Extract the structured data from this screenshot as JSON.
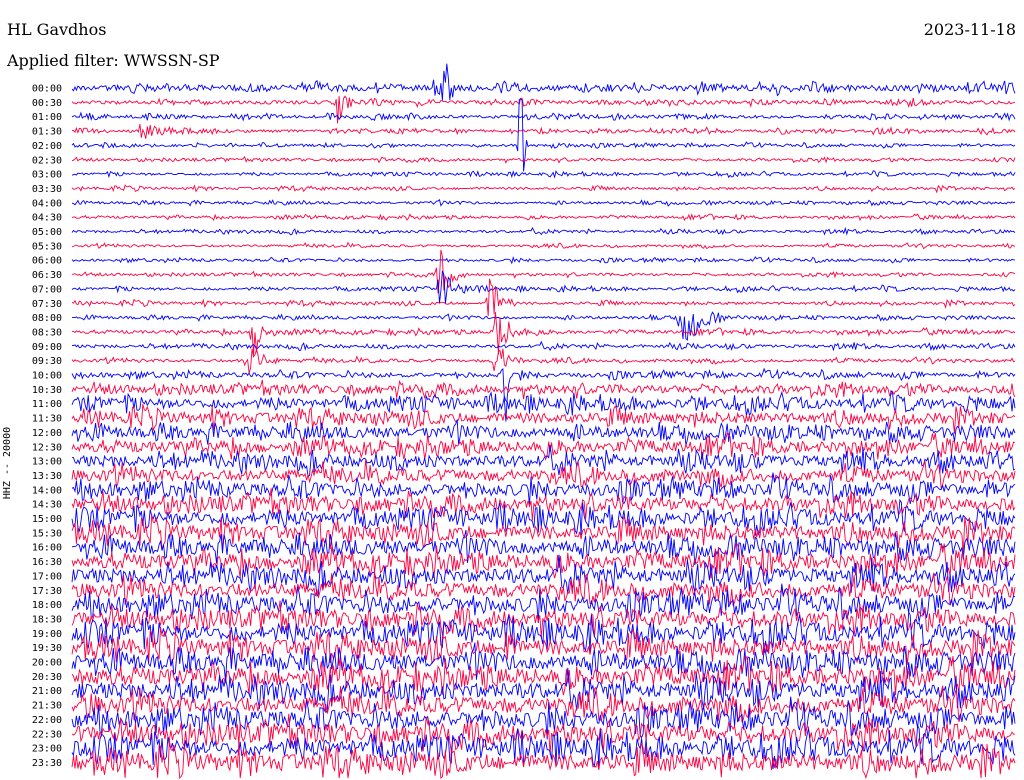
{
  "header": {
    "station": "HL Gavdhos",
    "date": "2023-11-18",
    "filter": "Applied filter: WWSSN-SP"
  },
  "chart_data": {
    "type": "line",
    "title": "HL Gavdhos",
    "ylabel": "HHZ -- 20000",
    "row_labels": [
      "00:00",
      "00:30",
      "01:00",
      "01:30",
      "02:00",
      "02:30",
      "03:00",
      "03:30",
      "04:00",
      "04:30",
      "05:00",
      "05:30",
      "06:00",
      "06:30",
      "07:00",
      "07:30",
      "08:00",
      "08:30",
      "09:00",
      "09:30",
      "10:00",
      "10:30",
      "11:00",
      "11:30",
      "12:00",
      "12:30",
      "13:00",
      "13:30",
      "14:00",
      "14:30",
      "15:00",
      "15:30",
      "16:00",
      "16:30",
      "17:00",
      "17:30",
      "18:00",
      "18:30",
      "19:00",
      "19:30",
      "20:00",
      "20:30",
      "21:00",
      "21:30",
      "22:00",
      "22:30",
      "23:00",
      "23:30"
    ],
    "row_colors": [
      "#0000ff",
      "#ff0040"
    ],
    "x_minutes_per_row": 30,
    "relative_noise_amplitude": [
      0.35,
      0.22,
      0.18,
      0.16,
      0.14,
      0.14,
      0.14,
      0.14,
      0.14,
      0.14,
      0.14,
      0.14,
      0.14,
      0.14,
      0.16,
      0.16,
      0.16,
      0.18,
      0.18,
      0.18,
      0.26,
      0.45,
      0.55,
      0.6,
      0.6,
      0.62,
      0.65,
      0.7,
      0.72,
      0.75,
      0.78,
      0.8,
      0.8,
      0.82,
      0.85,
      0.85,
      0.88,
      0.88,
      0.9,
      0.9,
      0.9,
      0.92,
      0.92,
      0.95,
      0.95,
      0.95,
      0.95,
      0.95
    ],
    "events": [
      {
        "row": 0,
        "minute": 11.9,
        "amplitude": 6.5,
        "duration_min": 0.3
      },
      {
        "row": 1,
        "minute": 8.5,
        "amplitude": 3.5,
        "duration_min": 0.4
      },
      {
        "row": 3,
        "minute": 2.2,
        "amplitude": 1.2,
        "duration_min": 1.5
      },
      {
        "row": 4,
        "minute": 14.3,
        "amplitude": 15,
        "duration_min": 0.2
      },
      {
        "row": 13,
        "minute": 11.7,
        "amplitude": 4.5,
        "duration_min": 0.8
      },
      {
        "row": 14,
        "minute": 11.7,
        "amplitude": 2.8,
        "duration_min": 1.3
      },
      {
        "row": 15,
        "minute": 13.3,
        "amplitude": 4.5,
        "duration_min": 0.8
      },
      {
        "row": 16,
        "minute": 19.4,
        "amplitude": 5.5,
        "duration_min": 1.4
      },
      {
        "row": 17,
        "minute": 5.8,
        "amplitude": 4.5,
        "duration_min": 0.8
      },
      {
        "row": 17,
        "minute": 13.5,
        "amplitude": 3.8,
        "duration_min": 1.1
      },
      {
        "row": 19,
        "minute": 5.6,
        "amplitude": 3.2,
        "duration_min": 1.0
      },
      {
        "row": 19,
        "minute": 13.5,
        "amplitude": 3.0,
        "duration_min": 1.0
      },
      {
        "row": 20,
        "minute": 13.8,
        "amplitude": 7.0,
        "duration_min": 0.2
      },
      {
        "row": 39,
        "minute": 13.8,
        "amplitude": 3.5,
        "duration_min": 0.4
      }
    ]
  }
}
